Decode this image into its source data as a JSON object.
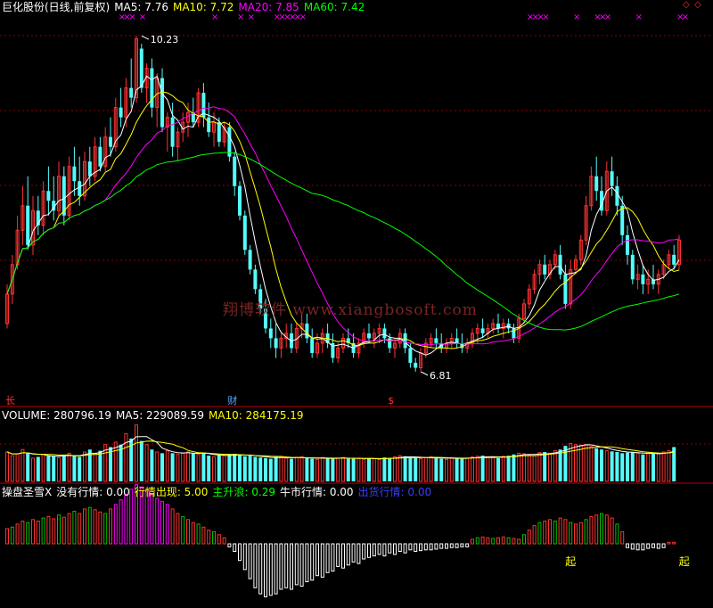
{
  "main_header": {
    "title": "巨化股份(日线,前复权)",
    "ma5": "MA5: 7.76",
    "ma10": "MA10: 7.72",
    "ma20": "MA20: 7.85",
    "ma60": "MA60: 7.42"
  },
  "vol_header": {
    "volume": "VOLUME: 280796.19",
    "ma5": "MA5: 229089.59",
    "ma10": "MA10: 284175.19"
  },
  "ind_header": {
    "name": "操盘圣雪X",
    "item1": "没有行情: 0.00",
    "item2": "行情出现: 5.00",
    "item3": "主升浪: 0.29",
    "item4": "牛市行情: 0.00",
    "item5": "出货行情: 0.00"
  },
  "watermark": "翔博软件 www.xiangbosoft.com",
  "colors": {
    "up": "#ff3232",
    "down": "#54fcfc",
    "ma5": "#ffffff",
    "ma10": "#ffff00",
    "ma20": "#ff00ff",
    "ma60": "#00ff00",
    "grid": "#8b0000",
    "mark": "#ff00ff"
  },
  "chart_data": [
    {
      "type": "candlestick",
      "annotations": [
        {
          "text": "10.23",
          "x": 26,
          "y": 10.23
        },
        {
          "text": "6.81",
          "x": 80,
          "y": 6.81
        }
      ],
      "event_labels": [
        {
          "text": "长",
          "x": 0
        },
        {
          "text": "财",
          "x": 43
        },
        {
          "text": "$",
          "x": 74
        }
      ],
      "top_marks": {
        "text": "×",
        "x": [
          22,
          23,
          24,
          26,
          40,
          45,
          47,
          52,
          53,
          54,
          55,
          56,
          57,
          101,
          102,
          103,
          104,
          110,
          114,
          115,
          116,
          122,
          130,
          131
        ]
      },
      "candles_ohlc": [
        [
          7.3,
          7.7,
          7.25,
          7.6
        ],
        [
          7.6,
          8.0,
          7.5,
          7.9
        ],
        [
          7.9,
          8.4,
          7.85,
          8.25
        ],
        [
          8.25,
          8.7,
          8.1,
          8.5
        ],
        [
          8.5,
          8.8,
          8.05,
          8.1
        ],
        [
          8.1,
          8.6,
          8.0,
          8.45
        ],
        [
          8.45,
          8.6,
          8.2,
          8.3
        ],
        [
          8.3,
          8.75,
          8.2,
          8.65
        ],
        [
          8.65,
          8.9,
          8.4,
          8.55
        ],
        [
          8.55,
          8.8,
          8.35,
          8.45
        ],
        [
          8.45,
          8.95,
          8.4,
          8.8
        ],
        [
          8.8,
          8.9,
          8.3,
          8.4
        ],
        [
          8.4,
          9.0,
          8.35,
          8.9
        ],
        [
          8.9,
          9.1,
          8.6,
          8.75
        ],
        [
          8.75,
          9.0,
          8.5,
          8.6
        ],
        [
          8.6,
          9.05,
          8.55,
          8.95
        ],
        [
          8.95,
          9.1,
          8.7,
          8.8
        ],
        [
          8.8,
          9.2,
          8.75,
          9.1
        ],
        [
          9.1,
          9.2,
          8.85,
          8.9
        ],
        [
          8.9,
          9.3,
          8.85,
          9.2
        ],
        [
          9.2,
          9.4,
          9.0,
          9.1
        ],
        [
          9.1,
          9.6,
          9.05,
          9.5
        ],
        [
          9.5,
          9.7,
          9.3,
          9.4
        ],
        [
          9.4,
          9.8,
          9.3,
          9.7
        ],
        [
          9.7,
          10.0,
          9.5,
          9.6
        ],
        [
          9.6,
          10.23,
          9.55,
          10.2
        ],
        [
          10.1,
          10.15,
          9.65,
          9.7
        ],
        [
          9.7,
          9.95,
          9.55,
          9.9
        ],
        [
          9.9,
          10.0,
          9.4,
          9.5
        ],
        [
          9.5,
          9.85,
          9.3,
          9.8
        ],
        [
          9.8,
          9.9,
          9.25,
          9.3
        ],
        [
          9.3,
          9.45,
          9.05,
          9.4
        ],
        [
          9.4,
          9.55,
          9.0,
          9.1
        ],
        [
          9.1,
          9.3,
          8.95,
          9.25
        ],
        [
          9.25,
          9.45,
          9.15,
          9.35
        ],
        [
          9.35,
          9.55,
          9.2,
          9.45
        ],
        [
          9.45,
          9.6,
          9.3,
          9.35
        ],
        [
          9.35,
          9.7,
          9.3,
          9.65
        ],
        [
          9.65,
          9.75,
          9.3,
          9.4
        ],
        [
          9.4,
          9.55,
          9.2,
          9.25
        ],
        [
          9.25,
          9.45,
          9.1,
          9.35
        ],
        [
          9.35,
          9.4,
          9.1,
          9.15
        ],
        [
          9.15,
          9.35,
          9.1,
          9.3
        ],
        [
          9.3,
          9.35,
          8.95,
          9.0
        ],
        [
          9.0,
          9.05,
          8.6,
          8.7
        ],
        [
          8.7,
          8.75,
          8.35,
          8.4
        ],
        [
          8.4,
          8.45,
          8.0,
          8.05
        ],
        [
          8.05,
          8.1,
          7.8,
          7.85
        ],
        [
          7.85,
          7.9,
          7.6,
          7.65
        ],
        [
          7.65,
          7.7,
          7.4,
          7.45
        ],
        [
          7.45,
          7.55,
          7.2,
          7.25
        ],
        [
          7.25,
          7.35,
          7.05,
          7.15
        ],
        [
          7.15,
          7.3,
          6.95,
          7.05
        ],
        [
          7.05,
          7.2,
          6.95,
          7.15
        ],
        [
          7.15,
          7.3,
          7.05,
          7.2
        ],
        [
          7.2,
          7.3,
          7.0,
          7.05
        ],
        [
          7.05,
          7.3,
          7.0,
          7.25
        ],
        [
          7.25,
          7.4,
          7.15,
          7.3
        ],
        [
          7.3,
          7.4,
          7.1,
          7.15
        ],
        [
          7.15,
          7.25,
          6.95,
          7.0
        ],
        [
          7.0,
          7.2,
          6.95,
          7.1
        ],
        [
          7.1,
          7.25,
          7.0,
          7.2
        ],
        [
          7.2,
          7.3,
          7.05,
          7.1
        ],
        [
          7.1,
          7.2,
          6.9,
          6.95
        ],
        [
          6.95,
          7.1,
          6.9,
          7.05
        ],
        [
          7.05,
          7.2,
          7.0,
          7.15
        ],
        [
          7.15,
          7.25,
          7.05,
          7.1
        ],
        [
          7.1,
          7.2,
          6.95,
          7.0
        ],
        [
          7.0,
          7.15,
          6.95,
          7.1
        ],
        [
          7.1,
          7.25,
          7.05,
          7.2
        ],
        [
          7.2,
          7.3,
          7.1,
          7.15
        ],
        [
          7.15,
          7.25,
          7.05,
          7.2
        ],
        [
          7.2,
          7.3,
          7.1,
          7.25
        ],
        [
          7.25,
          7.3,
          7.1,
          7.15
        ],
        [
          7.15,
          7.2,
          7.0,
          7.05
        ],
        [
          7.05,
          7.15,
          6.95,
          7.1
        ],
        [
          7.1,
          7.25,
          7.05,
          7.2
        ],
        [
          7.2,
          7.25,
          7.0,
          7.05
        ],
        [
          7.05,
          7.1,
          6.85,
          6.9
        ],
        [
          6.9,
          6.95,
          6.81,
          6.85
        ],
        [
          6.85,
          7.05,
          6.82,
          7.0
        ],
        [
          7.0,
          7.15,
          6.95,
          7.1
        ],
        [
          7.1,
          7.2,
          7.05,
          7.15
        ],
        [
          7.15,
          7.25,
          7.05,
          7.1
        ],
        [
          7.1,
          7.2,
          7.0,
          7.05
        ],
        [
          7.05,
          7.15,
          7.0,
          7.1
        ],
        [
          7.1,
          7.2,
          7.05,
          7.15
        ],
        [
          7.15,
          7.25,
          7.05,
          7.1
        ],
        [
          7.1,
          7.2,
          7.0,
          7.05
        ],
        [
          7.05,
          7.15,
          7.0,
          7.1
        ],
        [
          7.1,
          7.25,
          7.05,
          7.2
        ],
        [
          7.2,
          7.3,
          7.1,
          7.25
        ],
        [
          7.25,
          7.35,
          7.15,
          7.2
        ],
        [
          7.2,
          7.3,
          7.15,
          7.25
        ],
        [
          7.25,
          7.35,
          7.2,
          7.3
        ],
        [
          7.3,
          7.4,
          7.2,
          7.25
        ],
        [
          7.25,
          7.35,
          7.15,
          7.3
        ],
        [
          7.3,
          7.35,
          7.2,
          7.25
        ],
        [
          7.25,
          7.3,
          7.1,
          7.15
        ],
        [
          7.15,
          7.4,
          7.1,
          7.35
        ],
        [
          7.35,
          7.55,
          7.3,
          7.5
        ],
        [
          7.5,
          7.7,
          7.45,
          7.65
        ],
        [
          7.65,
          7.85,
          7.6,
          7.8
        ],
        [
          7.8,
          7.95,
          7.7,
          7.9
        ],
        [
          7.9,
          8.0,
          7.75,
          7.8
        ],
        [
          7.8,
          7.95,
          7.75,
          7.9
        ],
        [
          7.9,
          8.05,
          7.85,
          8.0
        ],
        [
          8.0,
          8.1,
          7.75,
          7.8
        ],
        [
          7.8,
          7.9,
          7.45,
          7.5
        ],
        [
          7.5,
          7.95,
          7.45,
          7.85
        ],
        [
          7.85,
          8.0,
          7.8,
          7.95
        ],
        [
          7.95,
          8.2,
          7.9,
          8.15
        ],
        [
          8.15,
          8.6,
          8.1,
          8.5
        ],
        [
          8.5,
          8.9,
          8.45,
          8.8
        ],
        [
          8.8,
          9.0,
          8.55,
          8.65
        ],
        [
          8.65,
          8.8,
          8.4,
          8.45
        ],
        [
          8.45,
          8.95,
          8.4,
          8.85
        ],
        [
          8.85,
          9.0,
          8.6,
          8.7
        ],
        [
          8.7,
          8.8,
          8.4,
          8.5
        ],
        [
          8.5,
          8.6,
          8.1,
          8.2
        ],
        [
          8.2,
          8.3,
          7.9,
          8.0
        ],
        [
          8.0,
          8.05,
          7.7,
          7.75
        ],
        [
          7.75,
          7.9,
          7.65,
          7.8
        ],
        [
          7.8,
          7.9,
          7.6,
          7.7
        ],
        [
          7.7,
          7.85,
          7.6,
          7.75
        ],
        [
          7.75,
          7.9,
          7.65,
          7.7
        ],
        [
          7.7,
          7.85,
          7.6,
          7.8
        ],
        [
          7.8,
          7.95,
          7.75,
          7.9
        ],
        [
          7.9,
          8.05,
          7.85,
          8.0
        ],
        [
          8.0,
          8.1,
          7.85,
          7.9
        ],
        [
          7.9,
          8.2,
          7.85,
          8.15
        ]
      ]
    },
    {
      "type": "bar",
      "series": [
        {
          "name": "VOLUME",
          "values": [
            240,
            210,
            225,
            260,
            230,
            190,
            200,
            220,
            210,
            205,
            195,
            215,
            230,
            210,
            200,
            240,
            260,
            230,
            250,
            300,
            280,
            320,
            300,
            390,
            350,
            460,
            330,
            300,
            260,
            240,
            230,
            250,
            230,
            220,
            230,
            240,
            230,
            220,
            235,
            210,
            200,
            215,
            210,
            220,
            225,
            215,
            205,
            210,
            200,
            195,
            190,
            185,
            200,
            205,
            190,
            185,
            195,
            200,
            190,
            185,
            180,
            195,
            190,
            185,
            190,
            195,
            185,
            190,
            185,
            180,
            190,
            185,
            180,
            195,
            190,
            200,
            210,
            205,
            195,
            190,
            185,
            195,
            200,
            190,
            185,
            180,
            195,
            190,
            185,
            190,
            200,
            205,
            210,
            200,
            195,
            190,
            205,
            210,
            220,
            230,
            225,
            215,
            210,
            235,
            240,
            230,
            250,
            260,
            290,
            310,
            300,
            295,
            300,
            285,
            270,
            260,
            250,
            245,
            240,
            230,
            235,
            240,
            230,
            220,
            225,
            230,
            225,
            240,
            250,
            280
          ]
        }
      ]
    },
    {
      "type": "bar",
      "series": [
        {
          "name": "操盘圣雪X",
          "values": [
            2.0,
            2.2,
            2.6,
            3.0,
            2.8,
            3.2,
            3.0,
            3.4,
            3.6,
            3.3,
            3.8,
            3.5,
            4.0,
            4.3,
            4.0,
            4.6,
            4.8,
            4.5,
            4.2,
            4.0,
            4.6,
            5.2,
            5.8,
            6.5,
            7.2,
            7.8,
            7.5,
            7.2,
            6.6,
            6.0,
            5.6,
            5.2,
            4.6,
            4.0,
            3.6,
            3.2,
            2.8,
            2.6,
            2.2,
            1.8,
            1.6,
            1.2,
            0.8,
            -0.4,
            -1.0,
            -2.2,
            -3.4,
            -4.6,
            -5.8,
            -6.6,
            -7.0,
            -6.8,
            -6.6,
            -6.0,
            -5.8,
            -6.0,
            -5.4,
            -5.6,
            -5.0,
            -4.8,
            -4.2,
            -4.4,
            -3.8,
            -3.6,
            -3.0,
            -3.2,
            -2.8,
            -2.4,
            -2.6,
            -2.0,
            -1.8,
            -1.6,
            -1.4,
            -1.6,
            -1.2,
            -1.4,
            -1.0,
            -1.2,
            -0.8,
            -1.0,
            -0.9,
            -0.8,
            -0.8,
            -0.7,
            -0.6,
            -0.6,
            -0.5,
            -0.5,
            -0.4,
            -0.4,
            0.6,
            0.8,
            0.9,
            0.8,
            0.7,
            0.8,
            0.9,
            0.8,
            0.7,
            0.6,
            1.2,
            1.8,
            2.4,
            2.8,
            3.0,
            3.2,
            3.0,
            3.4,
            3.2,
            2.8,
            2.6,
            2.8,
            3.2,
            3.6,
            3.8,
            4.0,
            3.8,
            3.4,
            2.6,
            1.6,
            -0.5,
            -0.7,
            -0.8,
            -0.8,
            -0.6,
            -0.5,
            -0.6,
            -0.5,
            0.2,
            0.2
          ]
        }
      ],
      "markers": [
        {
          "text": "起",
          "x": 109
        },
        {
          "text": "起",
          "x": 131
        }
      ]
    }
  ]
}
